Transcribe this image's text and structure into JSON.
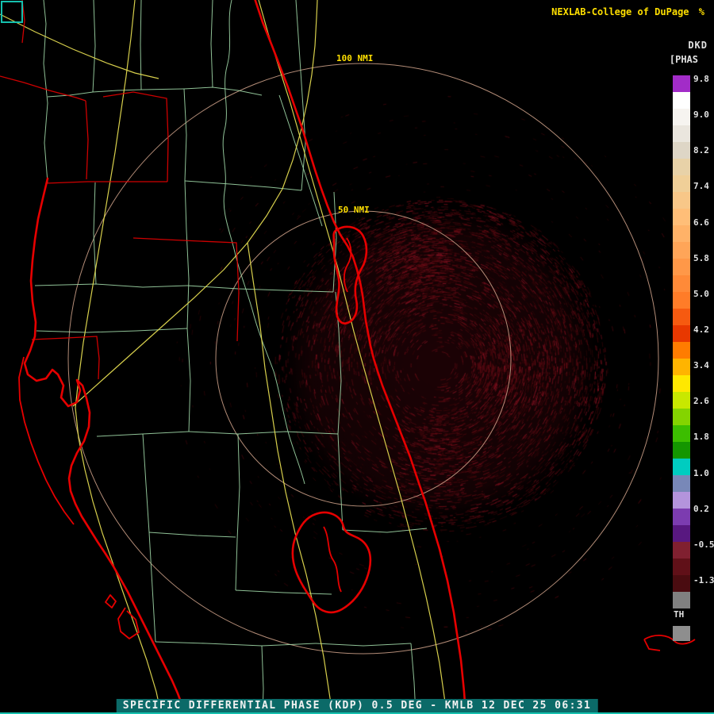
{
  "header": {
    "brand": "NEXLAB-College of DuPage",
    "brand_glyph": "%",
    "product_code": "DKD",
    "units": "[PHAS"
  },
  "rings": {
    "outer_label": "100 NMI",
    "inner_label": "50 NMI"
  },
  "colorbar": {
    "ticks": [
      "9.8",
      "9.0",
      "8.2",
      "7.4",
      "6.6",
      "5.8",
      "5.0",
      "4.2",
      "3.4",
      "2.6",
      "1.8",
      "1.0",
      "0.2",
      "-0.5",
      "-1.3"
    ],
    "threshold": "TH",
    "colors": [
      "#a22cc8",
      "#ffffff",
      "#f6f4f0",
      "#eae6de",
      "#ded6c6",
      "#e8d2a8",
      "#f0cf98",
      "#f8c788",
      "#ffbe78",
      "#ffb268",
      "#ffa558",
      "#ff9848",
      "#ff8a38",
      "#ff7c28",
      "#f65a10",
      "#e83800",
      "#ff7c00",
      "#ffb400",
      "#ffe800",
      "#c8e800",
      "#84d400",
      "#3cbe00",
      "#149600",
      "#00ccc0",
      "#7888b8",
      "#b494dc",
      "#7c3cb0",
      "#581880",
      "#802030",
      "#601018",
      "#4a0c10",
      "#808080"
    ],
    "bottom_block_color": "#8e8e8e"
  },
  "caption": "SPECIFIC DIFFERENTIAL PHASE (KDP) 0.5 DEG - KMLB 12 DEC 25 06:31",
  "colors": {
    "background": "#000000",
    "coastline": "#e60000",
    "county": "#9fd6a6",
    "road": "#e3da50",
    "ring": "#d2a48c",
    "label_yellow": "#ffdf00",
    "text_white": "#e2e2e2",
    "caption_bg": "#0b6a68",
    "border_teal": "#15c0ae",
    "echo_palette": [
      "#3a0508",
      "#4a070c",
      "#5a0911",
      "#6e0b15",
      "#821020"
    ]
  }
}
